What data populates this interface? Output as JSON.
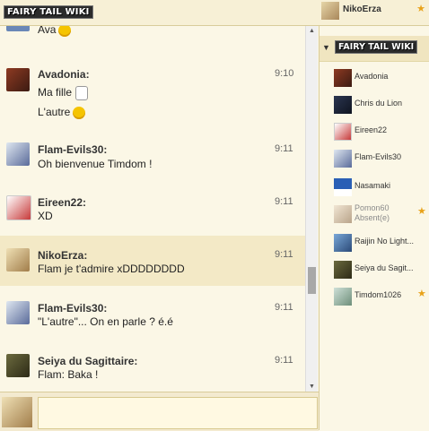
{
  "brand": {
    "logo_text": "FAIRY TAIL WIKI"
  },
  "current_user": {
    "name": "NikoErza",
    "star": "★"
  },
  "messages": [
    {
      "user": "",
      "time": "",
      "lines": [
        "Ava"
      ],
      "icon": "smile-emoji"
    },
    {
      "user": "Avadonia:",
      "time": "9:10",
      "lines": [
        "Ma fille",
        "L'autre"
      ]
    },
    {
      "user": "Flam-Evils30:",
      "time": "9:11",
      "lines": [
        "Oh bienvenue Timdom !"
      ]
    },
    {
      "user": "Eireen22:",
      "time": "9:11",
      "lines": [
        "XD"
      ]
    },
    {
      "user": "NikoErza:",
      "time": "9:11",
      "lines": [
        "Flam je t'admire xDDDDDDDD"
      ]
    },
    {
      "user": "Flam-Evils30:",
      "time": "9:11",
      "lines": [
        "\"L'autre\"... On en parle ? é.é"
      ]
    },
    {
      "user": "Seiya du Sagittaire:",
      "time": "9:11",
      "lines": [
        "Flam: Baka !"
      ]
    }
  ],
  "sidebar": {
    "collapse_icon": "▼",
    "members": [
      {
        "name": "Avadonia"
      },
      {
        "name": "Chris du Lion"
      },
      {
        "name": "Eireen22"
      },
      {
        "name": "Flam-Evils30"
      },
      {
        "name": "Nasamaki"
      },
      {
        "name": "Pomon60",
        "status": "Absent(e)",
        "star": "★"
      },
      {
        "name": "Raijin No Light..."
      },
      {
        "name": "Seiya du Sagit..."
      },
      {
        "name": "Timdom1026",
        "star": "★"
      }
    ]
  },
  "input": {
    "placeholder": ""
  },
  "colors": {
    "accent_star": "#e8a21a",
    "panel_bg": "#fbf7e6",
    "highlight_row": "#f3e9c6"
  }
}
